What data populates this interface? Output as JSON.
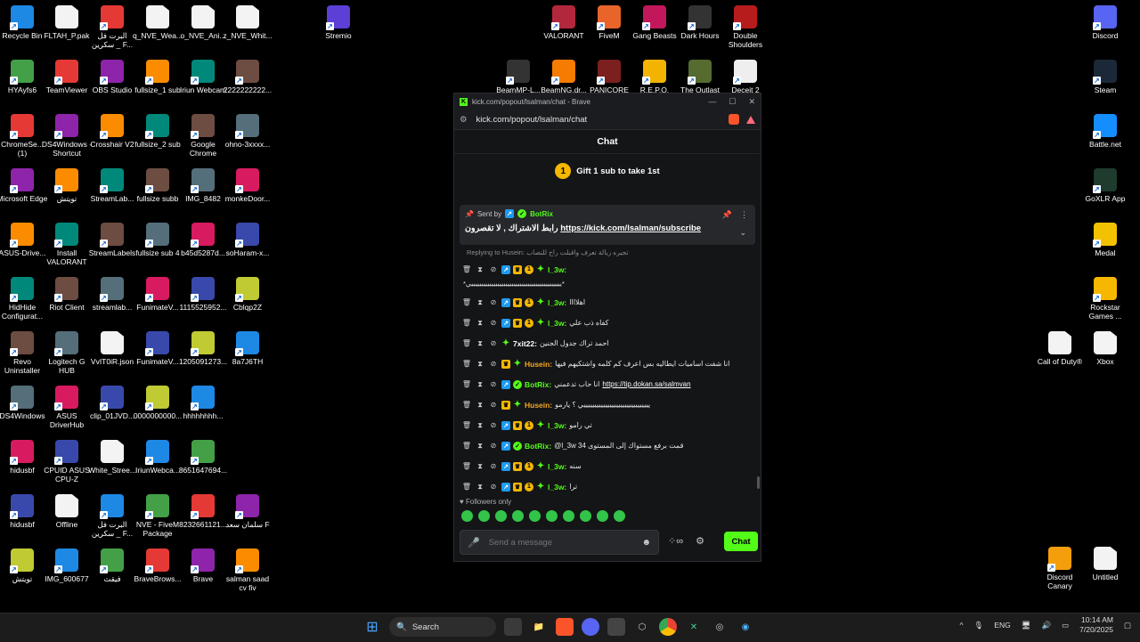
{
  "desktop": {
    "col1": [
      "Recycle Bin",
      "HYAyfs6",
      "ChromeSe... (1)",
      "Microsoft Edge",
      "ASUS-Drive...",
      "HidHide Configurat...",
      "Revo Uninstaller",
      "DS4Windows",
      "hidusbf",
      "hidusbf",
      "تويتش"
    ],
    "col2": [
      "FLTAH_P.pak",
      "TeamViewer",
      "DS4Windows - Shortcut",
      "تويتش",
      "Install VALORANT",
      "Riot Client",
      "Logitech G HUB",
      "ASUS DriverHub",
      "CPUID ASUS CPU-Z",
      "Offline",
      "IMG_600677"
    ],
    "col3": [
      "البرت فل سكرين _ F...",
      "OBS Studio",
      "Crosshair V2",
      "StreamLab...",
      "StreamLabels",
      "streamlab...",
      "VvIT0iR.json",
      "clip_01JVD...",
      "White_Stree...",
      "البرت فل سكرين _ F...",
      "فيقث"
    ],
    "col4": [
      "q_NVE_Wea...",
      "fullsize_1 sub",
      "fullsize_2 sub",
      "fullsize subb",
      "fullsize sub 4",
      "FunimateV...",
      "FunimateV...",
      "0000000000...",
      "IriunWebca...",
      "NVE - FiveM Package",
      "BraveBrows..."
    ],
    "col5": [
      "o_NVE_Ani...",
      "Iriun Webcam",
      "Google Chrome",
      "IMG_8482",
      "b45d5287d...",
      "1115525952...",
      "1205091273...",
      "hhhhhhhh...",
      "8651647694...",
      "8232661121...",
      "Brave"
    ],
    "col6": [
      "z_NVE_Whit...",
      "2222222222...",
      "ohno-3xxxx...",
      "monkeDoor...",
      "soHaram-x...",
      "Cblqp2Z",
      "8a7J6TH",
      "",
      "",
      "سلمان سعد F",
      "salman saad cv fiv"
    ],
    "stremio": "Stremio",
    "top_right": [
      "VALORANT",
      "FiveM",
      "Gang Beasts",
      "Dark Hours",
      "Double Shoulders"
    ],
    "top_right_row2": [
      "BeamMP-L...",
      "BeamNG.dr...",
      "PANICORE",
      "R.E.P.O.",
      "The Outlast",
      "Deceit 2"
    ],
    "far_right": [
      "Discord",
      "Steam",
      "Battle.net",
      "GoXLR App",
      "Medal",
      "Rockstar Games ...",
      "Xbox",
      "Discord Canary",
      "Untitled"
    ],
    "cod": "Call of Duty®"
  },
  "browser": {
    "title": "kick.com/popout/lsalman/chat - Brave",
    "url": "kick.com/popout/lsalman/chat"
  },
  "chat": {
    "header": "Chat",
    "gift_count": "1",
    "gift_text": "Gift 1 sub to take 1st",
    "pinned": {
      "sent_by": "Sent by",
      "bot": "BotRix",
      "msg_prefix": "رابط الاشتراك , لا تقصرون",
      "link": "https://kick.com/lsalman/subscribe"
    },
    "reply_label": "Replying to Husein: تجيره زيالة تعرف واقبلت راح للنصاب",
    "first_user": "l_3w:",
    "wrap_text": "*يييييييييييييييييييييييييييييييييييييييييييييي*",
    "messages": [
      {
        "user": "l_3w:",
        "color": "#53fc18",
        "text": "اهلاااا"
      },
      {
        "user": "l_3w:",
        "color": "#53fc18",
        "text": "كفاه ذب علي"
      },
      {
        "user": "7xit22:",
        "color": "#ffffff",
        "text": "احمد تراك جدول الجنين"
      },
      {
        "user": "Husein:",
        "color": "#f5a623",
        "text": "انا شفت اساميات ايطاليه بس اعرف كم كلمه واشتكيهم فيها"
      },
      {
        "user": "BotRix:",
        "color": "#53fc18",
        "text": "انا حاب تدعمني",
        "link": "https://tip.dokan.sa/salmvan"
      },
      {
        "user": "Husein:",
        "color": "#f5a623",
        "text": "يييييييييييييييييييييييييييييييي ؟ يارمو"
      },
      {
        "user": "l_3w:",
        "color": "#53fc18",
        "text": "تي رامو"
      },
      {
        "user": "BotRix:",
        "color": "#53fc18",
        "text": "@l_3w قمت برفع مستواك إلى المستوى 34"
      },
      {
        "user": "l_3w:",
        "color": "#53fc18",
        "text": "سنه"
      },
      {
        "user": "l_3w:",
        "color": "#53fc18",
        "text": "ترا"
      }
    ],
    "followers_only": "Followers only",
    "input_placeholder": "Send a message",
    "send_label": "Chat"
  },
  "taskbar": {
    "search": "Search",
    "lang": "ENG",
    "time": "10:14 AM",
    "date": "7/20/2025"
  }
}
